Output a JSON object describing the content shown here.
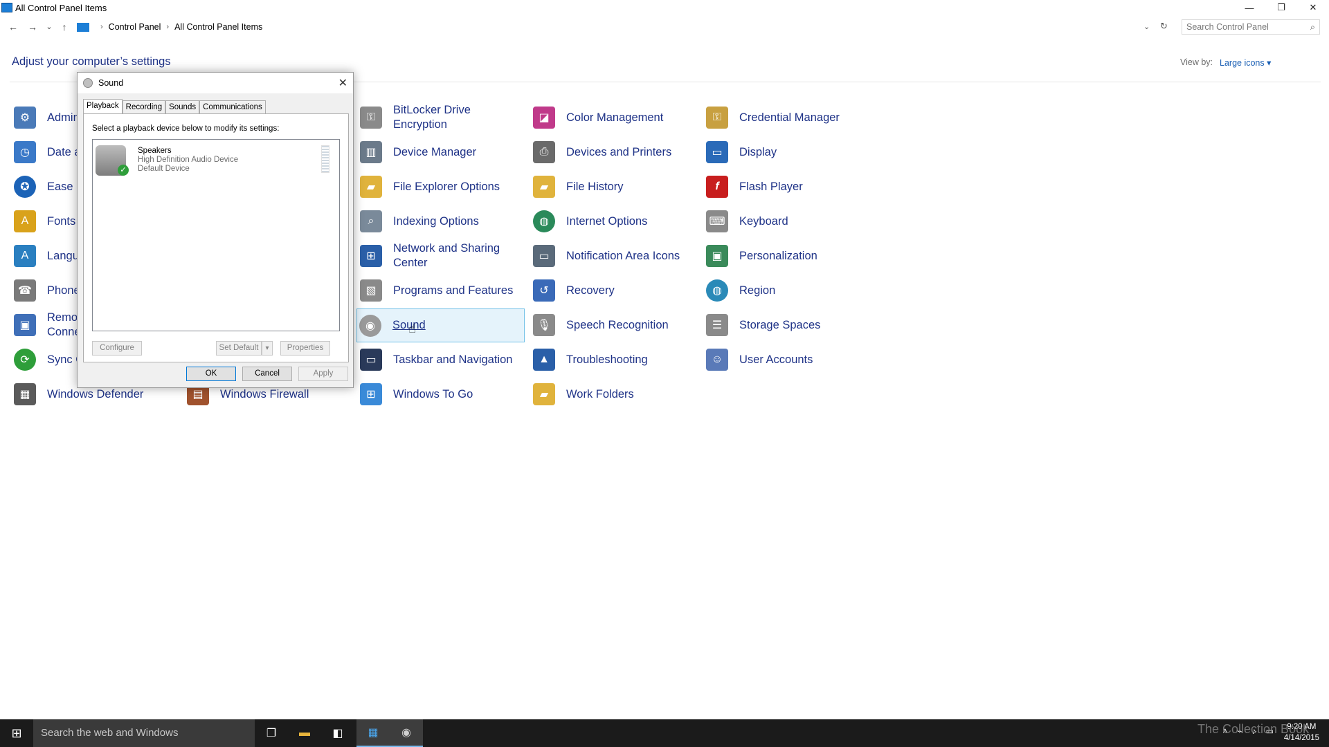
{
  "window": {
    "title": "All Control Panel Items",
    "controls": {
      "minimize": "—",
      "maximize": "❐",
      "close": "✕"
    }
  },
  "address_bar": {
    "back": "←",
    "forward": "→",
    "dropdown": "⌄",
    "up": "↑",
    "crumb1": "Control Panel",
    "crumb2": "All Control Panel Items",
    "sep": "›",
    "history_dropdown": "⌄",
    "refresh": "↻",
    "search_placeholder": "Search Control Panel",
    "search_icon": "⌕"
  },
  "header": {
    "heading": "Adjust your computer’s settings",
    "view_by_label": "View by:",
    "view_by_value": "Large icons ▾"
  },
  "items": {
    "c0r0": {
      "label": "Admini",
      "icon": "tools-icon",
      "color": "#4a7ab8"
    },
    "c0r1": {
      "label": "Date ar",
      "icon": "clock-icon",
      "color": "#3a79c8"
    },
    "c0r2": {
      "label": "Ease of",
      "icon": "accessibility-icon",
      "color": "#1c63b7"
    },
    "c0r3": {
      "label": "Fonts",
      "icon": "fonts-icon",
      "color": "#d9a21b"
    },
    "c0r4": {
      "label": "Langua",
      "icon": "language-icon",
      "color": "#2a7fc0"
    },
    "c0r5": {
      "label": "Phone",
      "icon": "phone-icon",
      "color": "#7a7a7a"
    },
    "c0r6a": {
      "label": "Remote"
    },
    "c0r6b": {
      "label": "Connec"
    },
    "c0r6icon": {
      "icon": "remote-icon",
      "color": "#3f6fb8"
    },
    "c0r7": {
      "label": "Sync C",
      "icon": "sync-icon",
      "color": "#2e9e3a"
    },
    "c0r8": {
      "label": "Windows Defender",
      "icon": "defender-icon",
      "color": "#5a5a5a"
    },
    "c1r8": {
      "label": "Windows Firewall",
      "icon": "firewall-icon",
      "color": "#a0522d"
    },
    "c2r0": {
      "label": "BitLocker Drive Encryption",
      "icon": "bitlocker-icon",
      "color": "#8a8a8a"
    },
    "c2r1": {
      "label": "Device Manager",
      "icon": "device-manager-icon",
      "color": "#6b7a8a"
    },
    "c2r2": {
      "label": "File Explorer Options",
      "icon": "folder-options-icon",
      "color": "#e0b33c"
    },
    "c2r3": {
      "label": "Indexing Options",
      "icon": "indexing-icon",
      "color": "#7a8a9a"
    },
    "c2r4a": {
      "label": "Network and Sharing"
    },
    "c2r4b": {
      "label": "Center"
    },
    "c2r4icon": {
      "icon": "network-icon",
      "color": "#2a5fa8"
    },
    "c2r5": {
      "label": "Programs and Features",
      "icon": "programs-icon",
      "color": "#8a8a8a"
    },
    "c2r6": {
      "label": "Sound",
      "icon": "speaker-icon",
      "color": "#9a9a9a"
    },
    "c2r7": {
      "label": "Taskbar and Navigation",
      "icon": "taskbar-icon",
      "color": "#2a3a5a"
    },
    "c2r8": {
      "label": "Windows To Go",
      "icon": "windows-to-go-icon",
      "color": "#3a8ad8"
    },
    "c3r0": {
      "label": "Color Management",
      "icon": "color-management-icon",
      "color": "#c03a8a"
    },
    "c3r1": {
      "label": "Devices and Printers",
      "icon": "printer-icon",
      "color": "#6a6a6a"
    },
    "c3r2": {
      "label": "File History",
      "icon": "file-history-icon",
      "color": "#e0b33c"
    },
    "c3r3": {
      "label": "Internet Options",
      "icon": "globe-icon",
      "color": "#2a8a5a"
    },
    "c3r4": {
      "label": "Notification Area Icons",
      "icon": "notification-icon",
      "color": "#5a6a7a"
    },
    "c3r5": {
      "label": "Recovery",
      "icon": "recovery-icon",
      "color": "#3a6ab8"
    },
    "c3r6": {
      "label": "Speech Recognition",
      "icon": "microphone-icon",
      "color": "#8a8a8a"
    },
    "c3r7": {
      "label": "Troubleshooting",
      "icon": "troubleshoot-icon",
      "color": "#2a5fa8"
    },
    "c3r8": {
      "label": "Work Folders",
      "icon": "work-folders-icon",
      "color": "#e0b33c"
    },
    "c4r0": {
      "label": "Credential Manager",
      "icon": "credential-icon",
      "color": "#c8a040"
    },
    "c4r1": {
      "label": "Display",
      "icon": "display-icon",
      "color": "#2a6ab8"
    },
    "c4r2": {
      "label": "Flash Player",
      "icon": "flash-icon",
      "color": "#c81e1e",
      "glyph": "f"
    },
    "c4r3": {
      "label": "Keyboard",
      "icon": "keyboard-icon",
      "color": "#8a8a8a"
    },
    "c4r4": {
      "label": "Personalization",
      "icon": "personalization-icon",
      "color": "#3a8a5a"
    },
    "c4r5": {
      "label": "Region",
      "icon": "region-icon",
      "color": "#2a8ab8"
    },
    "c4r6": {
      "label": "Storage Spaces",
      "icon": "storage-icon",
      "color": "#8a8a8a"
    },
    "c4r7": {
      "label": "User Accounts",
      "icon": "users-icon",
      "color": "#5a7ab8"
    }
  },
  "dialog": {
    "title": "Sound",
    "close": "✕",
    "tabs": [
      "Playback",
      "Recording",
      "Sounds",
      "Communications"
    ],
    "instruction": "Select a playback device below to modify its settings:",
    "device": {
      "name": "Speakers",
      "description": "High Definition Audio Device",
      "state": "Default Device",
      "check": "✓"
    },
    "buttons": {
      "configure": "Configure",
      "set_default": "Set Default",
      "set_default_arrow": "▾",
      "properties": "Properties",
      "ok": "OK",
      "cancel": "Cancel",
      "apply": "Apply"
    }
  },
  "taskbar": {
    "start": "⊞",
    "search_placeholder": "Search the web and Windows",
    "task_view": "❐",
    "explorer": "▬",
    "store": "◧",
    "control_panel": "▦",
    "sound_app": "◉",
    "tray_up": "˄",
    "tray_network": "⌁",
    "tray_volume": "♪",
    "tray_action": "▭",
    "time": "9:20 AM",
    "date": "4/14/2015",
    "watermark": "The Collection Book"
  }
}
